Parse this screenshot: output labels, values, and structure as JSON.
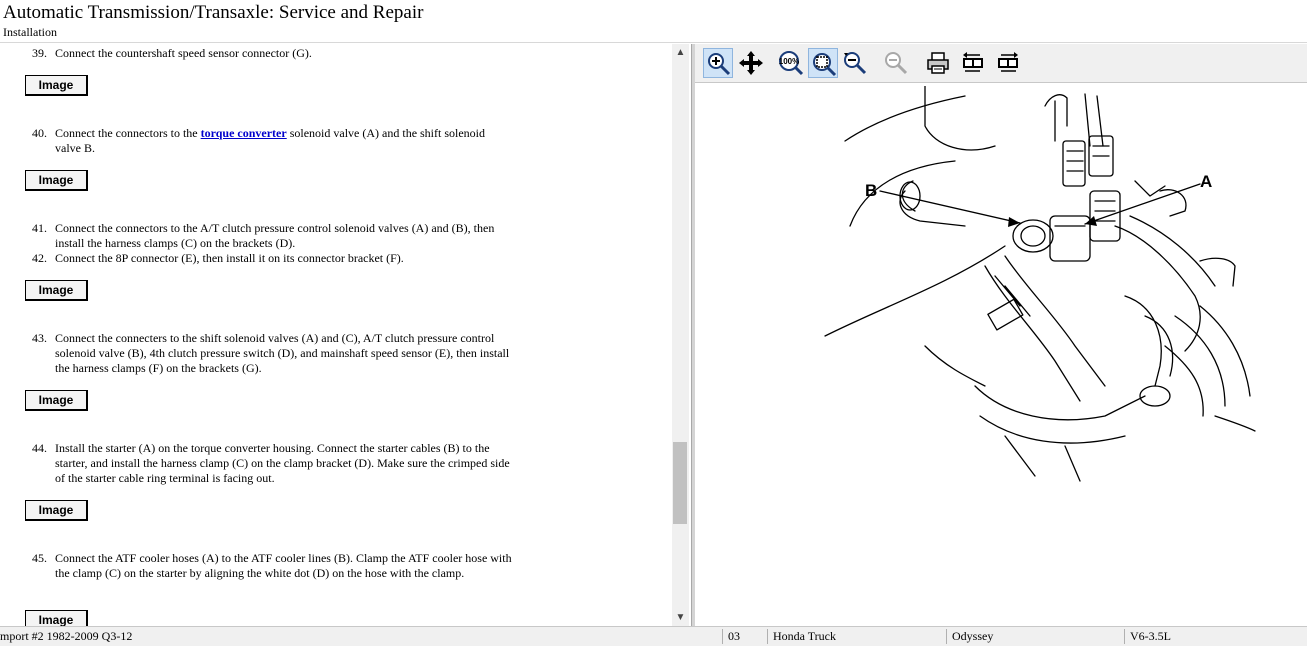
{
  "header": {
    "title": "Automatic Transmission/Transaxle:  Service and Repair",
    "subtitle": "Installation"
  },
  "steps": [
    {
      "num": "39.",
      "text": "Connect the countershaft speed sensor connector (G)."
    },
    {
      "num": "40.",
      "pre": "Connect the connectors to the ",
      "link": "torque converter",
      "post": " solenoid valve (A) and the shift solenoid valve B."
    },
    {
      "num": "41.",
      "text": "Connect the connectors to the A/T clutch pressure control solenoid valves (A) and (B), then install the harness clamps (C) on the brackets (D)."
    },
    {
      "num": "42.",
      "text": "Connect the 8P connector (E), then install it on its connector bracket (F)."
    },
    {
      "num": "43.",
      "text": "Connect the connecters to the shift solenoid valves (A) and (C), A/T clutch pressure control solenoid valve (B), 4th clutch pressure switch (D), and mainshaft speed sensor (E), then install the harness clamps (F) on the brackets (G)."
    },
    {
      "num": "44.",
      "text": "Install the starter (A) on the torque converter housing. Connect the starter cables (B) to the starter, and install the harness clamp (C) on the clamp bracket (D). Make sure the crimped side of the starter cable ring terminal is facing out."
    },
    {
      "num": "45.",
      "text": "Connect the ATF cooler hoses (A) to the ATF cooler lines (B). Clamp the ATF cooler hose with the clamp (C) on the starter by aligning the white dot (D) on the hose with the clamp."
    }
  ],
  "image_button_label": "Image",
  "scrollbar": {
    "up": "▲",
    "down": "▼"
  },
  "toolbar": {
    "buttons": [
      {
        "name": "zoom-in-icon",
        "active": true
      },
      {
        "name": "pan-icon",
        "active": false
      },
      {
        "name": "zoom-100-icon",
        "label": "100%",
        "active": false
      },
      {
        "name": "zoom-fit-icon",
        "active": true
      },
      {
        "name": "zoom-out-icon",
        "active": false
      },
      {
        "name": "zoom-out-disabled-icon",
        "active": false
      },
      {
        "name": "print-icon",
        "active": false
      },
      {
        "name": "rotate-left-icon",
        "active": false
      },
      {
        "name": "rotate-right-icon",
        "active": false
      }
    ]
  },
  "diagram": {
    "callout_a": "A",
    "callout_b": "B"
  },
  "status": {
    "import": "mport #2 1982-2009 Q3-12",
    "code": "03",
    "make": "Honda Truck",
    "model": "Odyssey",
    "engine": "V6-3.5L"
  }
}
